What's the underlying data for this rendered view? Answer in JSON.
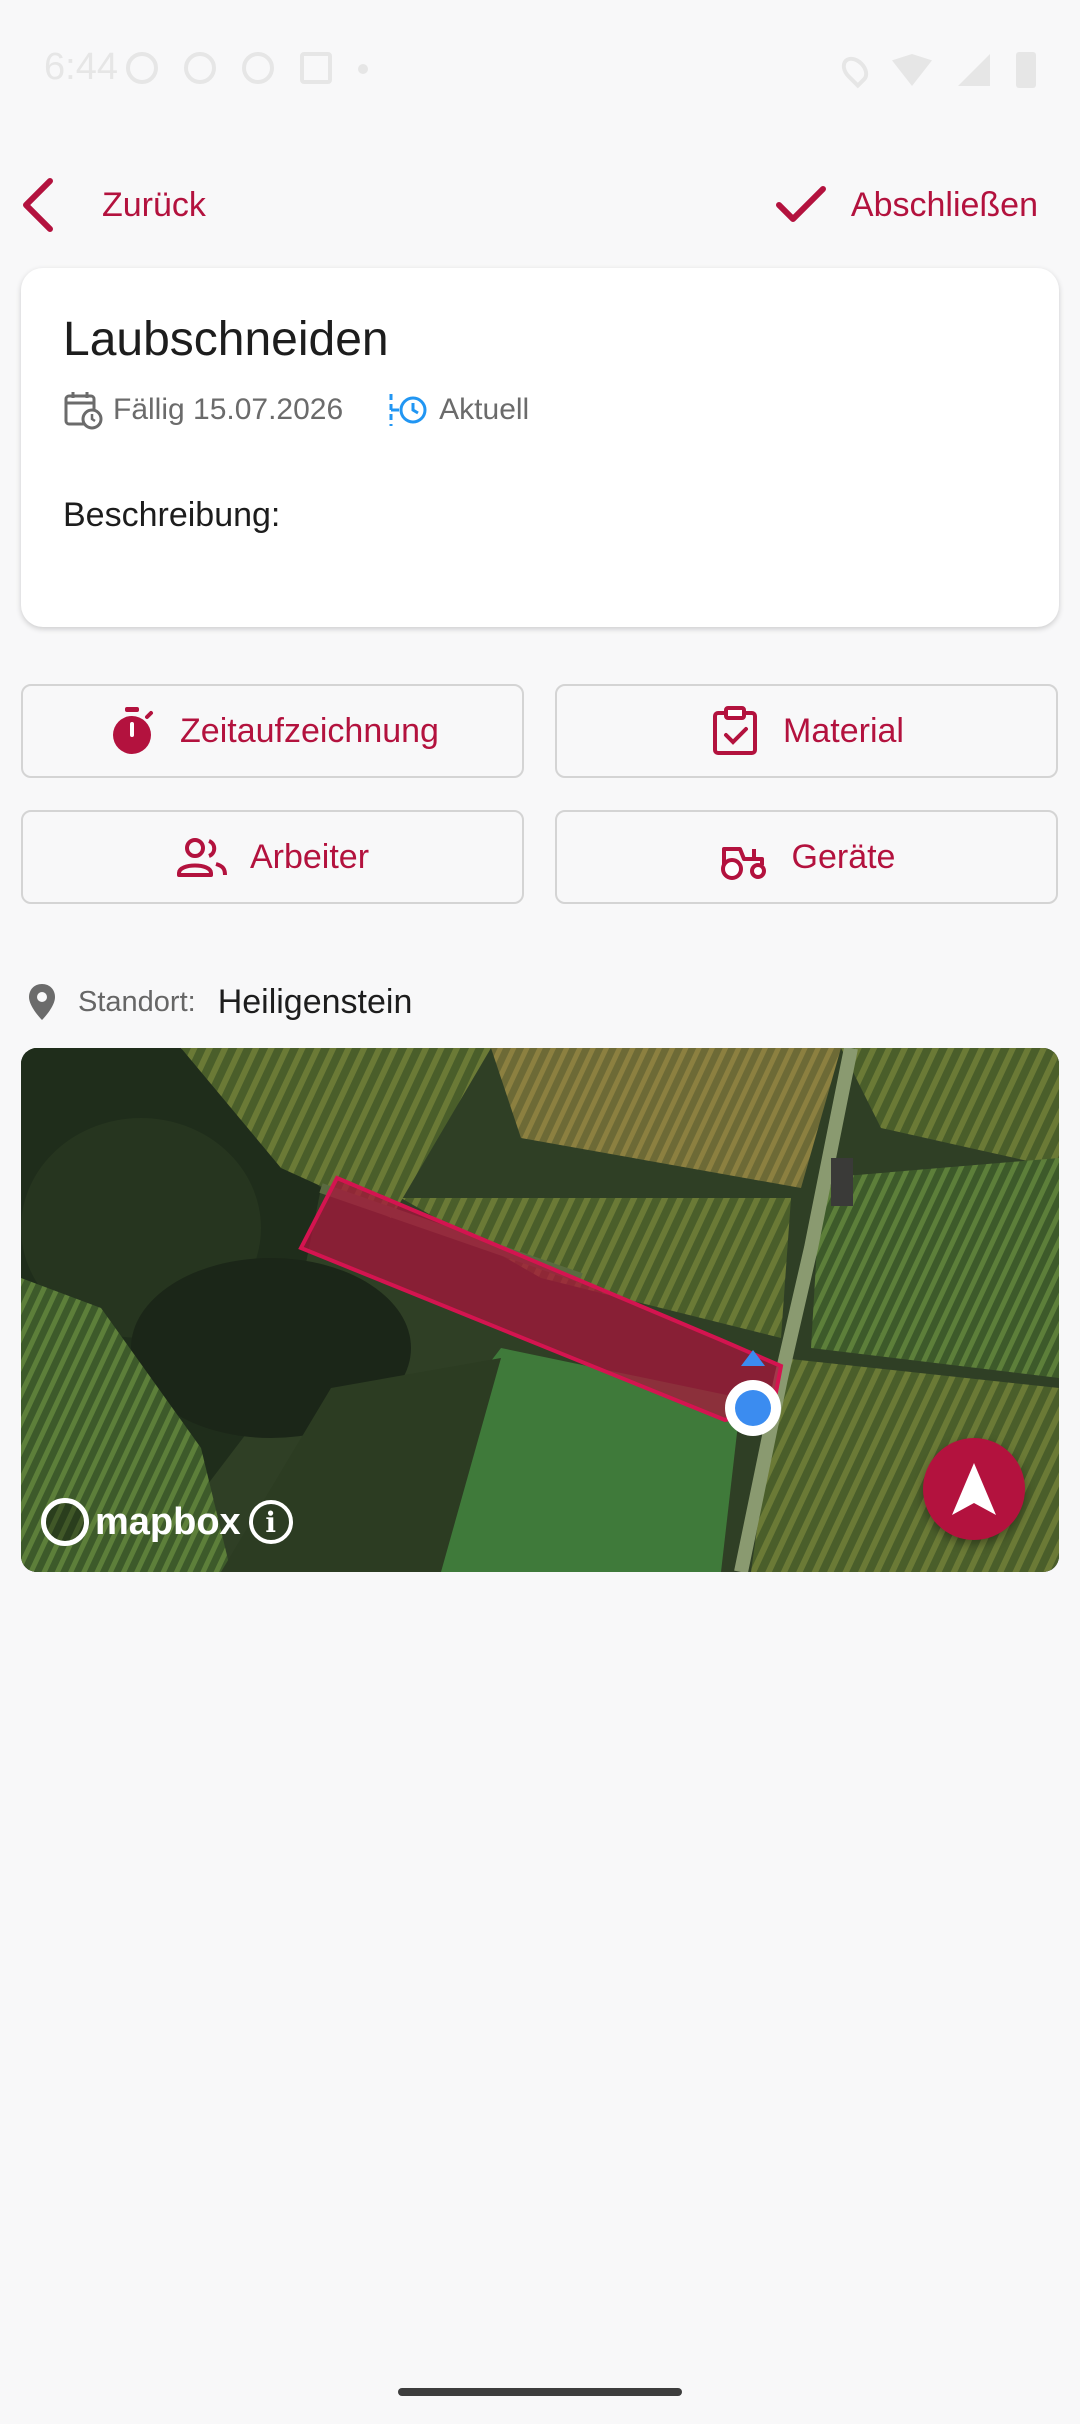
{
  "status_bar": {
    "time": "6:44"
  },
  "header": {
    "back_label": "Zurück",
    "finish_label": "Abschließen"
  },
  "task": {
    "title": "Laubschneiden",
    "due_text": "Fällig 15.07.2026",
    "status_text": "Aktuell",
    "description_label": "Beschreibung:"
  },
  "actions": {
    "time_tracking": "Zeitaufzeichnung",
    "material": "Material",
    "workers": "Arbeiter",
    "equipment": "Geräte"
  },
  "location": {
    "label": "Standort:",
    "value": "Heiligenstein"
  },
  "map": {
    "attribution": "mapbox"
  },
  "colors": {
    "accent": "#b3123e",
    "status_blue": "#2196f3",
    "user_location": "#3b8cf0"
  }
}
